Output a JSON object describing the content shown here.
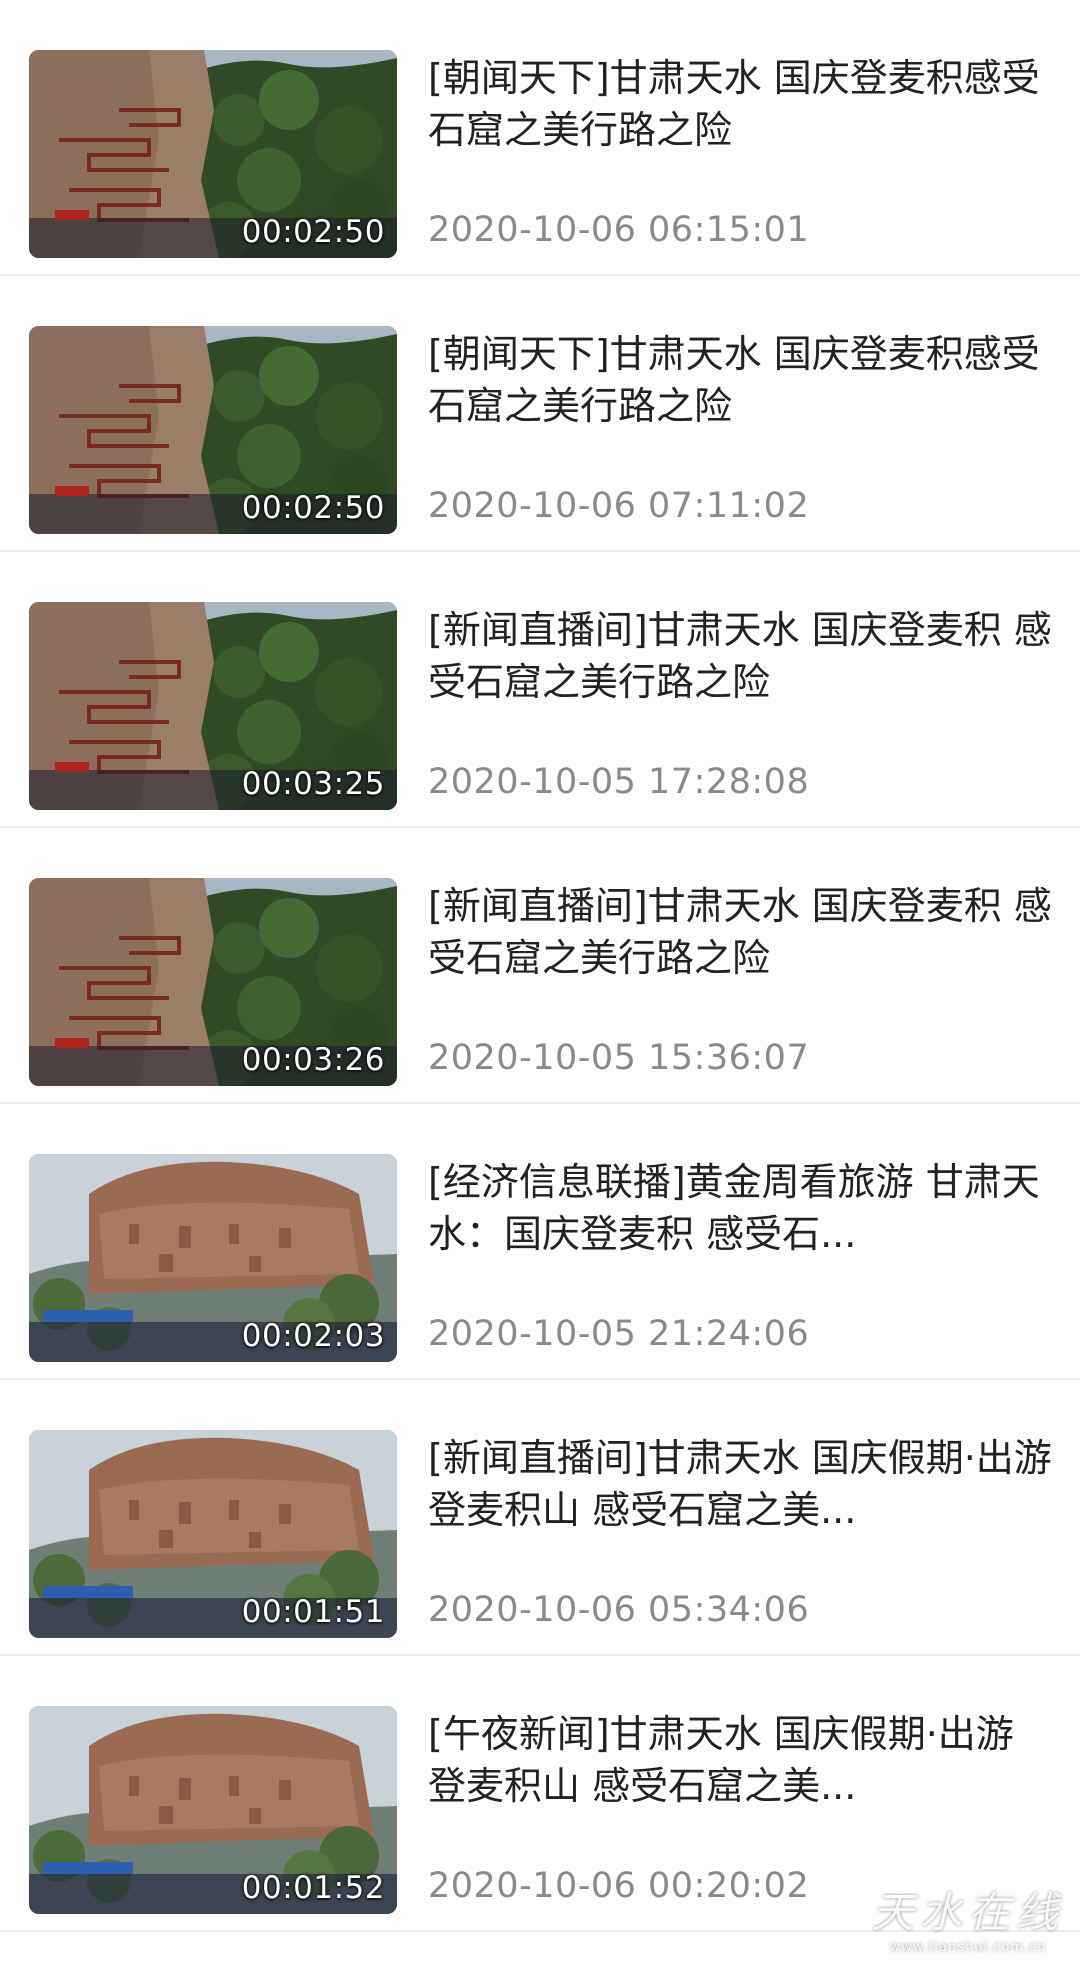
{
  "videos": [
    {
      "title": "[朝闻天下]甘肃天水 国庆登麦积感受石窟之美行路之险",
      "date": "2020-10-06 06:15:01",
      "duration": "00:02:50",
      "thumb": "cliff"
    },
    {
      "title": "[朝闻天下]甘肃天水 国庆登麦积感受石窟之美行路之险",
      "date": "2020-10-06 07:11:02",
      "duration": "00:02:50",
      "thumb": "cliff"
    },
    {
      "title": "[新闻直播间]甘肃天水 国庆登麦积 感受石窟之美行路之险",
      "date": "2020-10-05 17:28:08",
      "duration": "00:03:25",
      "thumb": "cliff"
    },
    {
      "title": "[新闻直播间]甘肃天水 国庆登麦积 感受石窟之美行路之险",
      "date": "2020-10-05 15:36:07",
      "duration": "00:03:26",
      "thumb": "cliff"
    },
    {
      "title": "[经济信息联播]黄金周看旅游 甘肃天水：国庆登麦积 感受石...",
      "date": "2020-10-05 21:24:06",
      "duration": "00:02:03",
      "thumb": "mountain"
    },
    {
      "title": "[新闻直播间]甘肃天水 国庆假期·出游 登麦积山 感受石窟之美...",
      "date": "2020-10-06 05:34:06",
      "duration": "00:01:51",
      "thumb": "mountain"
    },
    {
      "title": "[午夜新闻]甘肃天水 国庆假期·出游 登麦积山 感受石窟之美...",
      "date": "2020-10-06 00:20:02",
      "duration": "00:01:52",
      "thumb": "mountain"
    }
  ],
  "watermark": {
    "text": "天水在线",
    "url": "www.tianshui.com.cn"
  },
  "colors": {
    "title": "#222222",
    "date": "#8a8a8a",
    "divider": "#ececec"
  }
}
